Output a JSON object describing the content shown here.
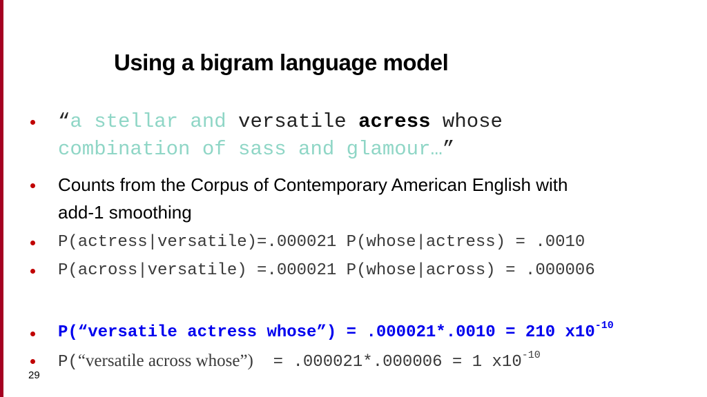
{
  "slide": {
    "title": "Using a bigram language model",
    "page_number": "29",
    "colors": {
      "accent_bar": "#a50021",
      "bullet": "#c00000",
      "context_text": "#8fd6c6",
      "highlight": "#0000ee"
    }
  },
  "bullets": {
    "quote": {
      "open_quote": "“",
      "context_before": "a stellar and",
      "versatile": " versatile ",
      "target": "acress",
      "whose": " whose",
      "context_after": "combination of sass and glamour…",
      "close_quote": "”"
    },
    "counts": {
      "line1": "Counts from the Corpus of Contemporary American English with",
      "line2": "add-1 smoothing"
    },
    "prob1": "P(actress|versatile)=.000021 P(whose|actress) = .0010",
    "prob2": "P(across|versatile) =.000021 P(whose|across) = .000006",
    "result1": {
      "prefix": "P(“versatile actress whose”) = .000021*.0010 = 210 x10",
      "exponent": "-10"
    },
    "result2": {
      "p_open": "P(",
      "quoted": "“versatile across whose”)",
      "rest": "  = .000021*.000006 = 1 x10",
      "exponent": "-10"
    }
  }
}
